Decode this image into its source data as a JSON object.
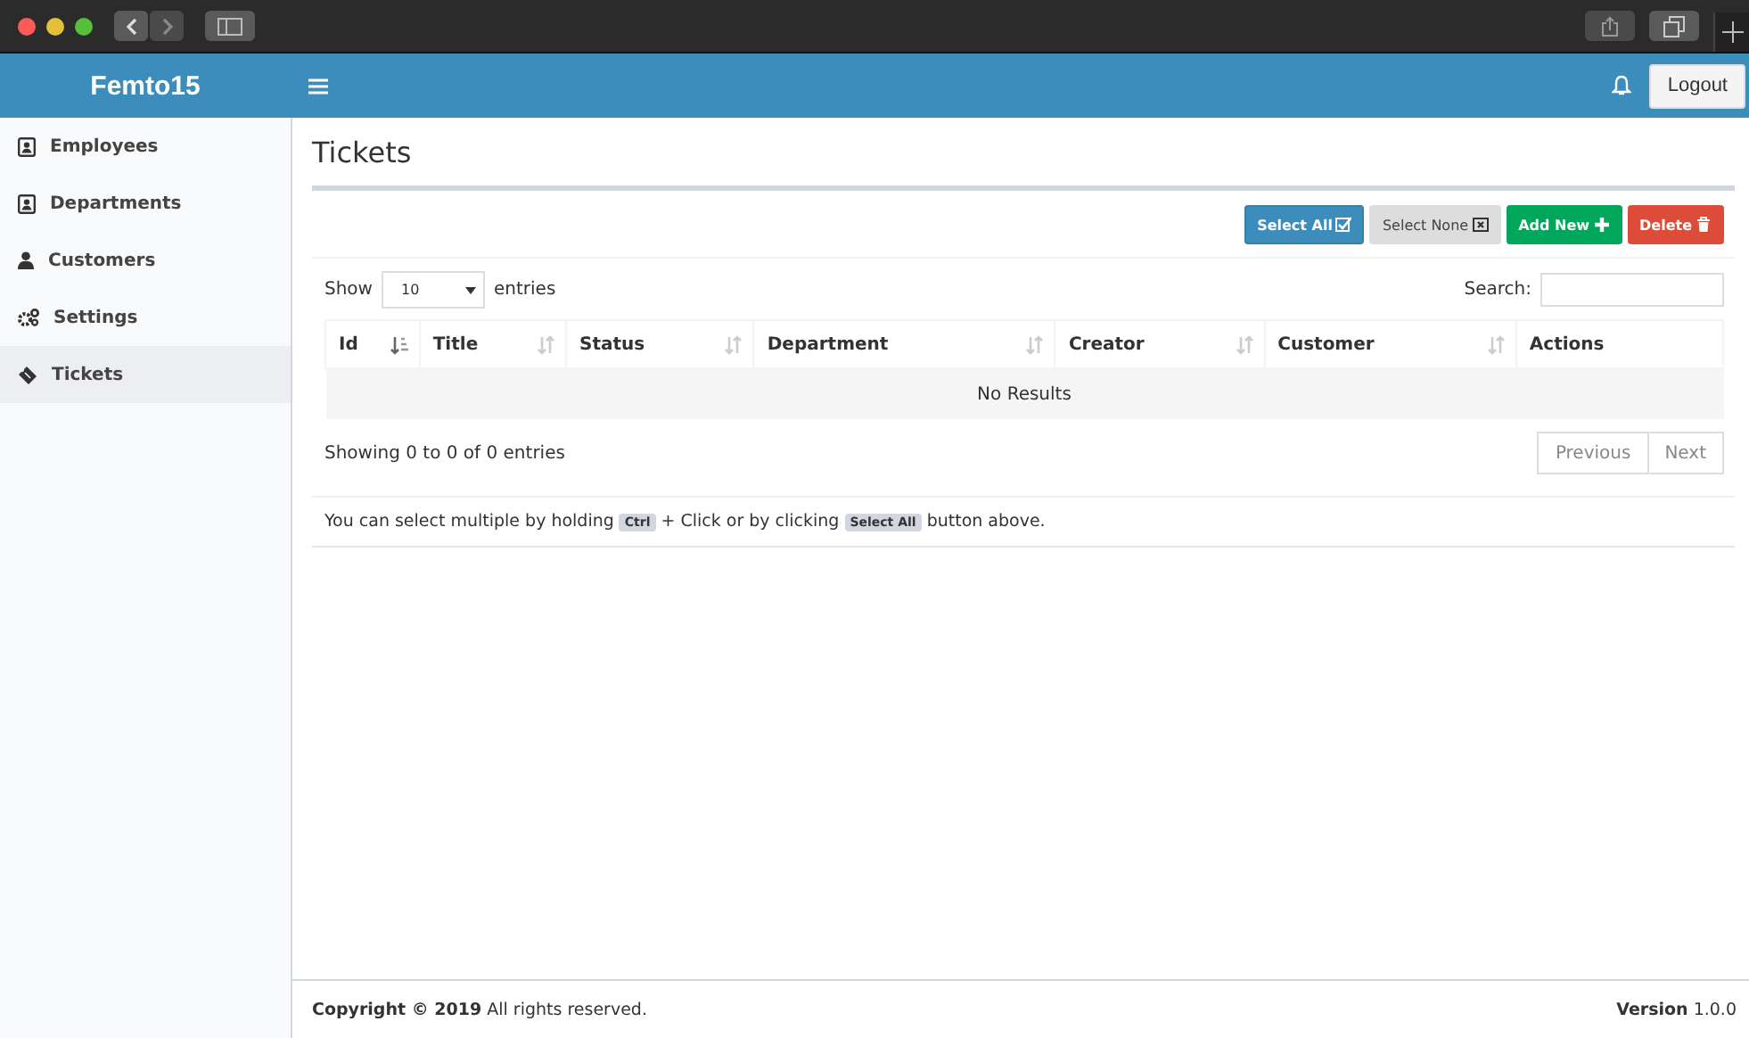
{
  "brand": "Femto15",
  "header": {
    "logout": "Logout"
  },
  "sidebar": {
    "items": [
      {
        "label": "Employees",
        "selected": false
      },
      {
        "label": "Departments",
        "selected": false
      },
      {
        "label": "Customers",
        "selected": false
      },
      {
        "label": "Settings",
        "selected": false
      },
      {
        "label": "Tickets",
        "selected": true
      }
    ]
  },
  "page_title": "Tickets",
  "toolbar": [
    {
      "label": "Select All",
      "kind": "primary"
    },
    {
      "label": "Select None",
      "kind": "default"
    },
    {
      "label": "Add New",
      "kind": "success"
    },
    {
      "label": "Delete",
      "kind": "danger"
    }
  ],
  "length": {
    "before": "Show",
    "value": "10",
    "after": "entries"
  },
  "search": {
    "label": "Search:"
  },
  "table": {
    "columns": [
      {
        "label": "Id",
        "sorted": true
      },
      {
        "label": "Title",
        "sorted": false
      },
      {
        "label": "Status",
        "sorted": false
      },
      {
        "label": "Department",
        "sorted": false
      },
      {
        "label": "Creator",
        "sorted": false
      },
      {
        "label": "Customer",
        "sorted": false
      },
      {
        "label": "Actions"
      }
    ],
    "empty": "No Results"
  },
  "info": "Showing 0 to 0 of 0 entries",
  "pagination": [
    {
      "label": "Previous",
      "disabled": true
    },
    {
      "label": "Next",
      "disabled": true
    }
  ],
  "note": [
    {
      "kind": "text",
      "text": "You can select multiple by holding"
    },
    {
      "kind": "key",
      "text": "Ctrl"
    },
    {
      "kind": "text",
      "text": "+ Click or by clicking"
    },
    {
      "kind": "key",
      "text": "Select All"
    },
    {
      "kind": "text",
      "text": "button above."
    }
  ],
  "footer": {
    "copyright": "**Copyright © 2019** All rights reserved.",
    "version": "**Version** 1.0.0"
  }
}
